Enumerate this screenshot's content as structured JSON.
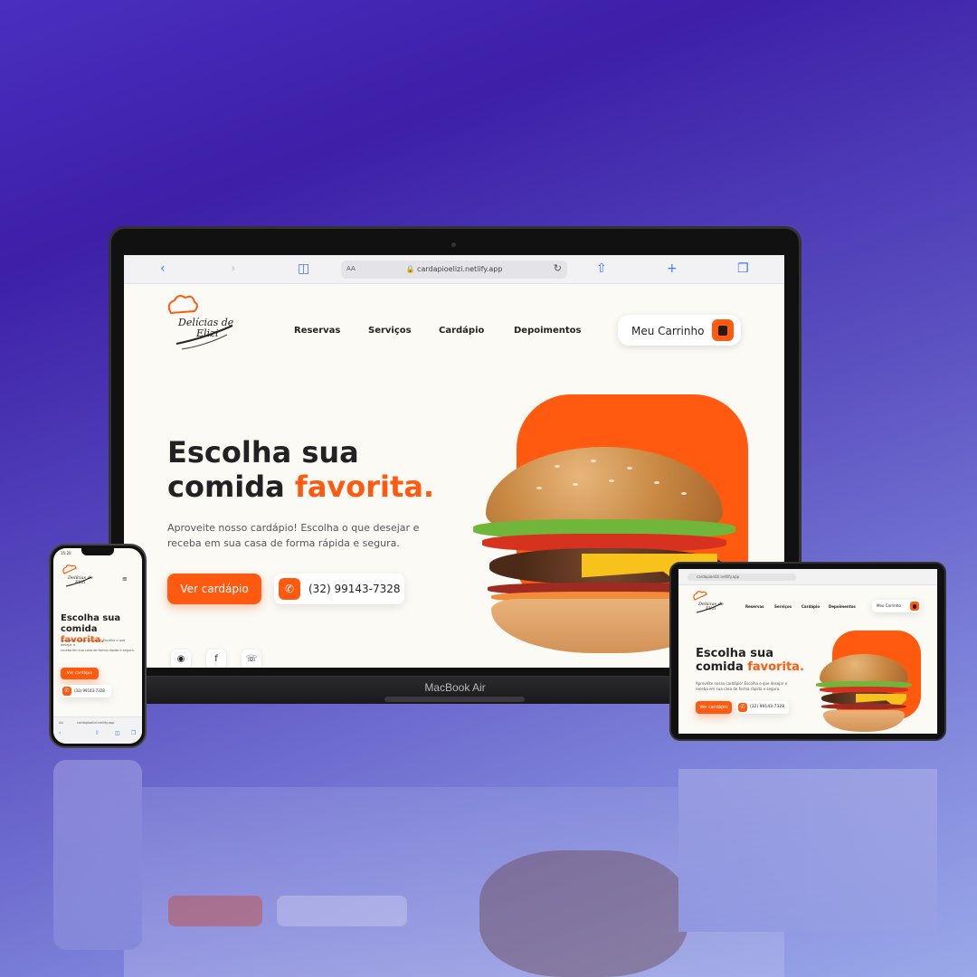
{
  "site": {
    "logo_text": "Delícias de Elizi",
    "url": "cardapioelizi.netlify.app",
    "url_aa": "AA",
    "nav": [
      "Reservas",
      "Serviços",
      "Cardápio",
      "Depoimentos"
    ],
    "cart_label": "Meu Carrinho",
    "hero_title_line1": "Escolha sua",
    "hero_title_line2_pre": "comida ",
    "hero_title_highlight": "favorita.",
    "hero_subtitle_line1": "Aproveite nosso cardápio! Escolha o que desejar e",
    "hero_subtitle_line2": "receba em sua casa de forma rápida e segura.",
    "cta_label": "Ver cardápio",
    "phone_number": "(32) 99143-7328",
    "phone_number_short": "(32) 99143-7328"
  },
  "laptop": {
    "brand": "MacBook Air"
  },
  "phone_device": {
    "time": "15:20",
    "url_short": "cardapioelizi.netlify.app",
    "aa": "AA"
  },
  "tablet_device": {
    "status_left": ""
  },
  "colors": {
    "accent": "#ff5a10",
    "background": "#fbfaf5",
    "text": "#222222"
  },
  "icons": {
    "back": "chevron-left-icon",
    "forward": "chevron-right-icon",
    "book": "book-icon",
    "lock": "lock-icon",
    "reload": "reload-icon",
    "share": "share-icon",
    "add": "plus-icon",
    "tabs": "tabs-icon",
    "cart": "shopping-bag-icon",
    "phone": "phone-icon",
    "instagram": "instagram-icon",
    "facebook": "facebook-icon",
    "whatsapp": "whatsapp-icon",
    "menu": "hamburger-menu-icon"
  }
}
